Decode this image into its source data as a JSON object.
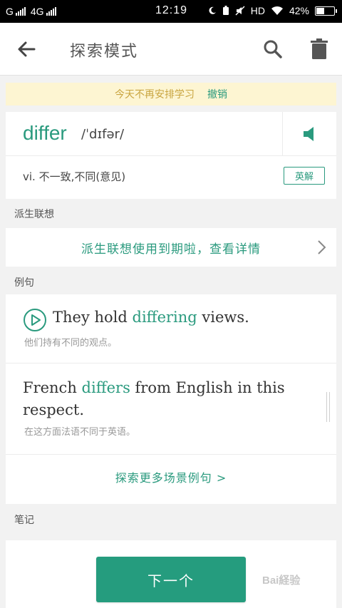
{
  "status_bar": {
    "carrier_left": "G",
    "network": "4G",
    "time": "12:19",
    "hd": "HD",
    "battery_percent": "42%",
    "battery_level": 0.42
  },
  "header": {
    "title": "探索模式"
  },
  "banner": {
    "message": "今天不再安排学习",
    "undo_label": "撤销"
  },
  "word": {
    "headword": "differ",
    "phonetic": "/ˈdɪfər/",
    "definition": "vi. 不一致,不同(意见)",
    "badge_label": "英解"
  },
  "sections": {
    "derivation_label": "派生联想",
    "examples_label": "例句",
    "notes_label": "笔记"
  },
  "derivation": {
    "message": "派生联想使用到期啦，查看详情"
  },
  "examples": [
    {
      "before": "They hold ",
      "highlight": "differing",
      "after": " views.",
      "translation": "他们持有不同的观点。"
    },
    {
      "before": "French ",
      "highlight": "differs",
      "after": " from English in this respect.",
      "translation": "在这方面法语不同于英语。"
    }
  ],
  "more_examples": "探索更多场景例句 >",
  "next_button": "下一个",
  "watermark": "Bai経验",
  "colors": {
    "accent": "#2a9a7e",
    "banner_bg": "#fdf5d2",
    "banner_text": "#c9a540",
    "button": "#259c7e"
  },
  "icons": {
    "back": "arrow-left-icon",
    "search": "search-icon",
    "trash": "trash-icon",
    "speaker": "speaker-icon",
    "play": "play-circle-icon",
    "chevron": "chevron-right-icon"
  }
}
